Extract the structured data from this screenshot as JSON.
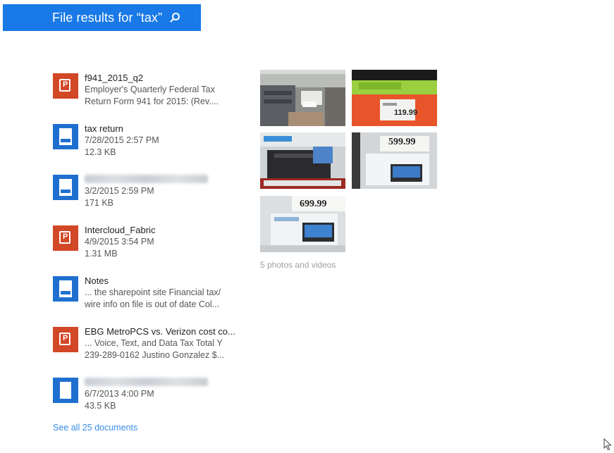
{
  "header": {
    "title": "File results for “tax”",
    "icon": "search-icon"
  },
  "files": [
    {
      "type": "pptx",
      "icon": "powerpoint-file-icon",
      "name": "f941_2015_q2",
      "line1": "Employer's Quarterly Federal Tax",
      "line2": "Return Form 941 for 2015: (Rev...."
    },
    {
      "type": "docx",
      "icon": "word-document-icon",
      "name": "tax return",
      "line1": "7/28/2015 2:57 PM",
      "line2": "12.3 KB"
    },
    {
      "type": "docx",
      "icon": "word-document-icon",
      "name": "",
      "name_redacted": true,
      "line1": "3/2/2015 2:59 PM",
      "line2": "171 KB"
    },
    {
      "type": "pptx",
      "icon": "powerpoint-file-icon",
      "name": "Intercloud_Fabric",
      "line1": "4/9/2015 3:54 PM",
      "line2": "1.31 MB"
    },
    {
      "type": "docx",
      "icon": "word-document-icon",
      "name": "Notes",
      "line1": "... the sharepoint site Financial tax/",
      "line2": "wire info on file is out of date Col..."
    },
    {
      "type": "pptx",
      "icon": "powerpoint-file-icon",
      "name": "EBG MetroPCS vs. Verizon cost co...",
      "line1": "... Voice, Text, and Data Tax Total Y",
      "line2": "239-289-0162 Justino Gonzalez $..."
    },
    {
      "type": "doc",
      "icon": "document-icon",
      "name": "",
      "name_redacted": true,
      "line1": "6/7/2013 4:00 PM",
      "line2": "43.5 KB"
    }
  ],
  "see_all": "See all 25 documents",
  "photos": {
    "caption": "5 photos and videos",
    "items": [
      {
        "icon": "store-aisle-photo",
        "price_tag": ""
      },
      {
        "icon": "price-tag-photo",
        "price_tag": "119.99"
      },
      {
        "icon": "printer-display-photo",
        "price_tag": ""
      },
      {
        "icon": "laptop-display-photo",
        "price_tag": "599.99"
      },
      {
        "icon": "laptop-display-photo",
        "price_tag": "699.99"
      }
    ]
  },
  "colors": {
    "header_bg": "#1979e6",
    "ppt": "#d24726",
    "word": "#1f6fd0",
    "link": "#3a8ee6"
  },
  "cursor_icon": "mouse-pointer-icon"
}
